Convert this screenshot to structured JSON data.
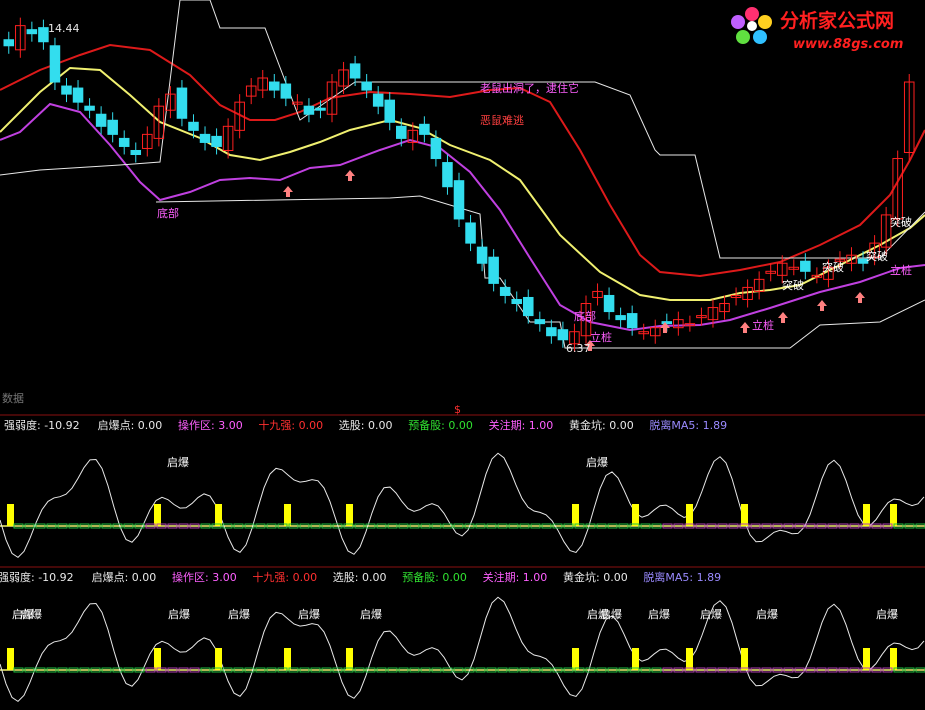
{
  "colors": {
    "up": "#ff2020",
    "down": "#33ddee",
    "red_line": "#dd1a1a",
    "yellow_line": "#f0f070",
    "magenta_line": "#c040e0",
    "white": "#e8e8e8",
    "label_magenta": "#ff60ff",
    "label_red": "#ff4040",
    "yellow_bar": "#ffff00",
    "green": "#20c040",
    "purple": "#b040b0",
    "divider": "#8a1010",
    "watermark_red": "#ff2020"
  },
  "watermark": {
    "title": "分析家公式网",
    "url": "www.88gs.com"
  },
  "main_panel": {
    "price_high_label": "14.44",
    "price_low_label": "6.37",
    "annotations": [
      {
        "id": "a1",
        "text": "老鼠出洞了，逮住它"
      },
      {
        "id": "a2",
        "text": "恶鼠难逃"
      },
      {
        "id": "a3",
        "text": "底部"
      },
      {
        "id": "a4",
        "text": "底部"
      },
      {
        "id": "a5",
        "text": "立桩"
      },
      {
        "id": "a6",
        "text": "立桩"
      },
      {
        "id": "a7",
        "text": "立桩"
      },
      {
        "id": "a8",
        "text": "突破"
      },
      {
        "id": "a9",
        "text": "突破"
      },
      {
        "id": "a10",
        "text": "突破"
      },
      {
        "id": "a11",
        "text": "突破"
      }
    ],
    "footer_label": "数据",
    "center_marker": "$"
  },
  "indicator1": {
    "header": [
      {
        "label": "强弱度:",
        "value": "-10.92",
        "color": "#e8e8e8"
      },
      {
        "label": "启爆点:",
        "value": "0.00",
        "color": "#e8e8e8"
      },
      {
        "label": "操作区:",
        "value": "3.00",
        "color": "#ff60ff"
      },
      {
        "label": "十九强:",
        "value": "0.00",
        "color": "#ff3030"
      },
      {
        "label": "选股:",
        "value": "0.00",
        "color": "#e8e8e8"
      },
      {
        "label": "预备股:",
        "value": "0.00",
        "color": "#30e030"
      },
      {
        "label": "关注期:",
        "value": "1.00",
        "color": "#ff60ff"
      },
      {
        "label": "黄金坑:",
        "value": "0.00",
        "color": "#e8e8e8"
      },
      {
        "label": "脱离MA5:",
        "value": "1.89",
        "color": "#9a8aff"
      }
    ],
    "labels": [
      "启爆",
      "启爆"
    ]
  },
  "indicator2": {
    "header": [
      {
        "label": "强弱度:",
        "value": "-10.92",
        "color": "#e8e8e8"
      },
      {
        "label": "启爆点:",
        "value": "0.00",
        "color": "#e8e8e8"
      },
      {
        "label": "操作区:",
        "value": "3.00",
        "color": "#ff60ff"
      },
      {
        "label": "十九强:",
        "value": "0.00",
        "color": "#ff3030"
      },
      {
        "label": "选股:",
        "value": "0.00",
        "color": "#e8e8e8"
      },
      {
        "label": "预备股:",
        "value": "0.00",
        "color": "#30e030"
      },
      {
        "label": "关注期:",
        "value": "1.00",
        "color": "#ff60ff"
      },
      {
        "label": "黄金坑:",
        "value": "0.00",
        "color": "#e8e8e8"
      },
      {
        "label": "脱离MA5:",
        "value": "1.89",
        "color": "#9a8aff"
      }
    ],
    "labels": [
      "启爆",
      "启爆",
      "启爆",
      "启爆",
      "启爆",
      "启爆",
      "启爆",
      "启爆",
      "启爆",
      "启爆",
      "启爆",
      "启爆"
    ]
  },
  "chart_data": {
    "type": "line",
    "price_range": [
      6.37,
      14.44
    ],
    "candles_approx_close": [
      13.8,
      14.3,
      14.1,
      13.9,
      12.9,
      12.6,
      12.4,
      12.2,
      11.8,
      11.6,
      11.3,
      11.1,
      11.6,
      12.3,
      12.6,
      12.0,
      11.7,
      11.4,
      11.3,
      11.8,
      12.4,
      12.8,
      13.0,
      12.7,
      12.5,
      12.4,
      12.1,
      12.2,
      12.9,
      13.2,
      13.0,
      12.7,
      12.3,
      11.9,
      11.5,
      11.7,
      11.6,
      11.0,
      10.3,
      9.5,
      8.9,
      8.4,
      7.9,
      7.6,
      7.4,
      7.1,
      6.9,
      6.6,
      6.5,
      6.7,
      7.4,
      7.7,
      7.2,
      7.0,
      6.8,
      6.7,
      6.8,
      6.9,
      7.0,
      6.9,
      7.1,
      7.3,
      7.4,
      7.6,
      7.8,
      8.0,
      8.2,
      8.4,
      8.3,
      8.2,
      8.1,
      8.3,
      8.5,
      8.6,
      8.4,
      8.9,
      9.6,
      11.0,
      12.9
    ]
  }
}
